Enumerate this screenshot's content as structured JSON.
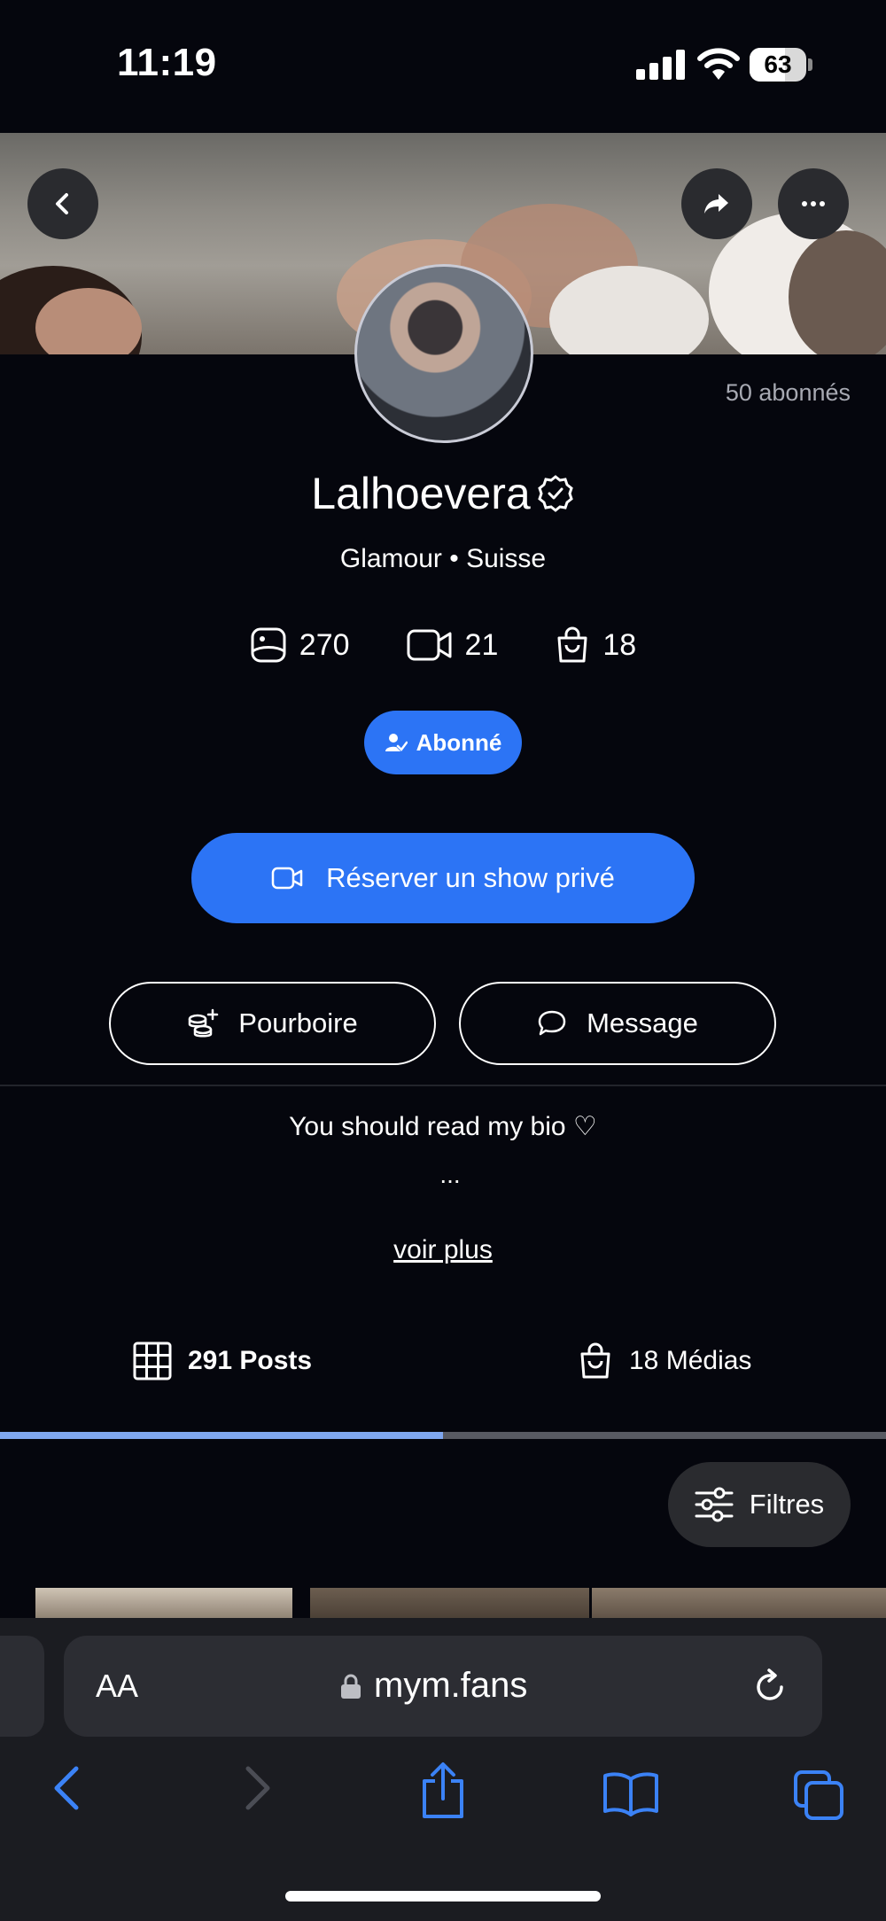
{
  "status_bar": {
    "time": "11:19",
    "battery_level": 63
  },
  "profile": {
    "subscribers": "50 abonnés",
    "name": "Lalhoevera",
    "subtitle": "Glamour • Suisse",
    "stats": {
      "photos": "270",
      "videos": "21",
      "shop": "18"
    },
    "follow_label": "Abonné",
    "private_show_label": "Réserver un show privé",
    "tip_label": "Pourboire",
    "message_label": "Message",
    "bio": "You should read my bio ♡",
    "bio_ellipsis": "...",
    "see_more": "voir plus"
  },
  "tabs": {
    "posts_count": "291",
    "posts_label": "Posts",
    "medias_label": "18 Médias",
    "active": "posts"
  },
  "filters_label": "Filtres",
  "browser": {
    "text_size": "AA",
    "domain": "mym.fans"
  },
  "colors": {
    "accent": "#2c74f5",
    "background": "#05060d",
    "tab_indicator": "#7fa7f0",
    "safari_blue": "#3b82f6"
  },
  "icons": [
    "chevron-left-icon",
    "share-arrow-icon",
    "more-icon",
    "verified-badge-icon",
    "photo-icon",
    "video-icon",
    "shopping-bag-icon",
    "user-check-icon",
    "video-camera-icon",
    "coins-icon",
    "chat-bubble-icon",
    "grid-icon",
    "sliders-icon",
    "lock-icon",
    "reload-icon",
    "back-arrow-icon",
    "forward-arrow-icon",
    "share-icon",
    "bookmarks-icon",
    "tabs-icon"
  ]
}
